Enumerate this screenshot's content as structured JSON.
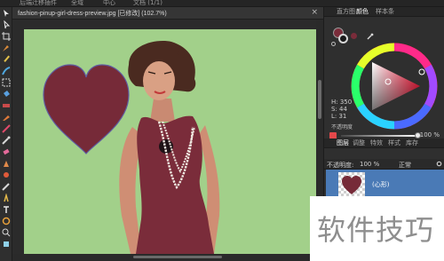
{
  "app": {
    "menubar": {
      "item_1": "后端迁移插件",
      "item_2": "全域",
      "item_3": "中心",
      "item_4": "文档 (1/1)"
    }
  },
  "document": {
    "title": "fashion-pinup-girl-dress-preview.jpg [已修改] (102.7%)",
    "close_glyph": "×"
  },
  "tools": [
    "move-tool",
    "node-tool",
    "crop-tool",
    "pen-tool",
    "pencil-tool",
    "vector-brush-tool",
    "fill-tool",
    "gradient-tool",
    "transparency-tool",
    "paint-brush-tool",
    "color-picker-tool",
    "eraser-tool",
    "clone-tool",
    "smudge-tool",
    "dodge-tool",
    "burn-tool",
    "text-tool",
    "shape-tool",
    "zoom-tool",
    "view-tool"
  ],
  "colors_panel": {
    "tabs": [
      "直方图",
      "颜色",
      "样本条"
    ],
    "active_tab": 1,
    "fill_color": "#7a2c3a",
    "h_label": "H: 350",
    "s_label": "S: 44",
    "l_label": "L: 31",
    "opacity_label": "不透明度",
    "opacity_value": "100 %",
    "opacity_level": 1.0
  },
  "layers_panel": {
    "tabs": [
      "图层",
      "调整",
      "特效",
      "样式",
      "库存"
    ],
    "active_tab": 0,
    "opacity_label": "不透明度:",
    "opacity_value": "100 %",
    "blend_mode": "正常",
    "layer_name": "(心形)"
  },
  "canvas_colors": {
    "background": "#a2d08a",
    "heart": "#762a38",
    "dress": "#7a2c3a"
  },
  "watermark": {
    "text": "软件技巧"
  }
}
